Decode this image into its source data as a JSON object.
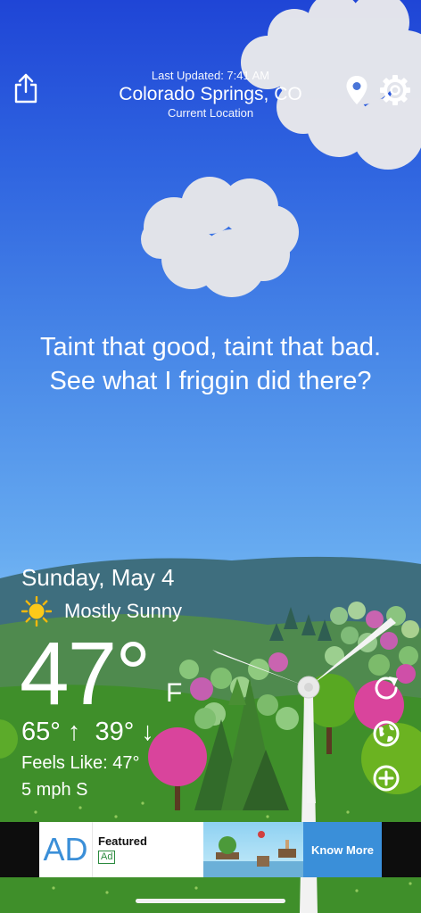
{
  "header": {
    "last_updated": "Last Updated: 7:41 AM",
    "location_name": "Colorado Springs, CO",
    "location_sub": "Current Location"
  },
  "quote": "Taint that good, taint that bad. See what I friggin did there?",
  "weather": {
    "date": "Sunday, May 4",
    "condition": "Mostly Sunny",
    "temperature": "47°",
    "unit": "F",
    "hi_lo": "65° ↑  39° ↓",
    "feels_like": "Feels Like: 47°",
    "wind": "5 mph S"
  },
  "icons": {
    "share": "share-icon",
    "location_pin": "location-pin-icon",
    "settings": "gear-icon",
    "condition": "sun-icon",
    "refresh": "refresh-icon",
    "globe": "globe-icon",
    "add": "plus-icon"
  },
  "ad": {
    "logo": "AD",
    "title": "Featured",
    "badge": "Ad",
    "cta": "Know More"
  },
  "colors": {
    "sky_top": "#1f45d6",
    "sky_bottom": "#8fc9f2",
    "grass": "#3f8f2a",
    "ad_cta": "#3a8fd9"
  }
}
